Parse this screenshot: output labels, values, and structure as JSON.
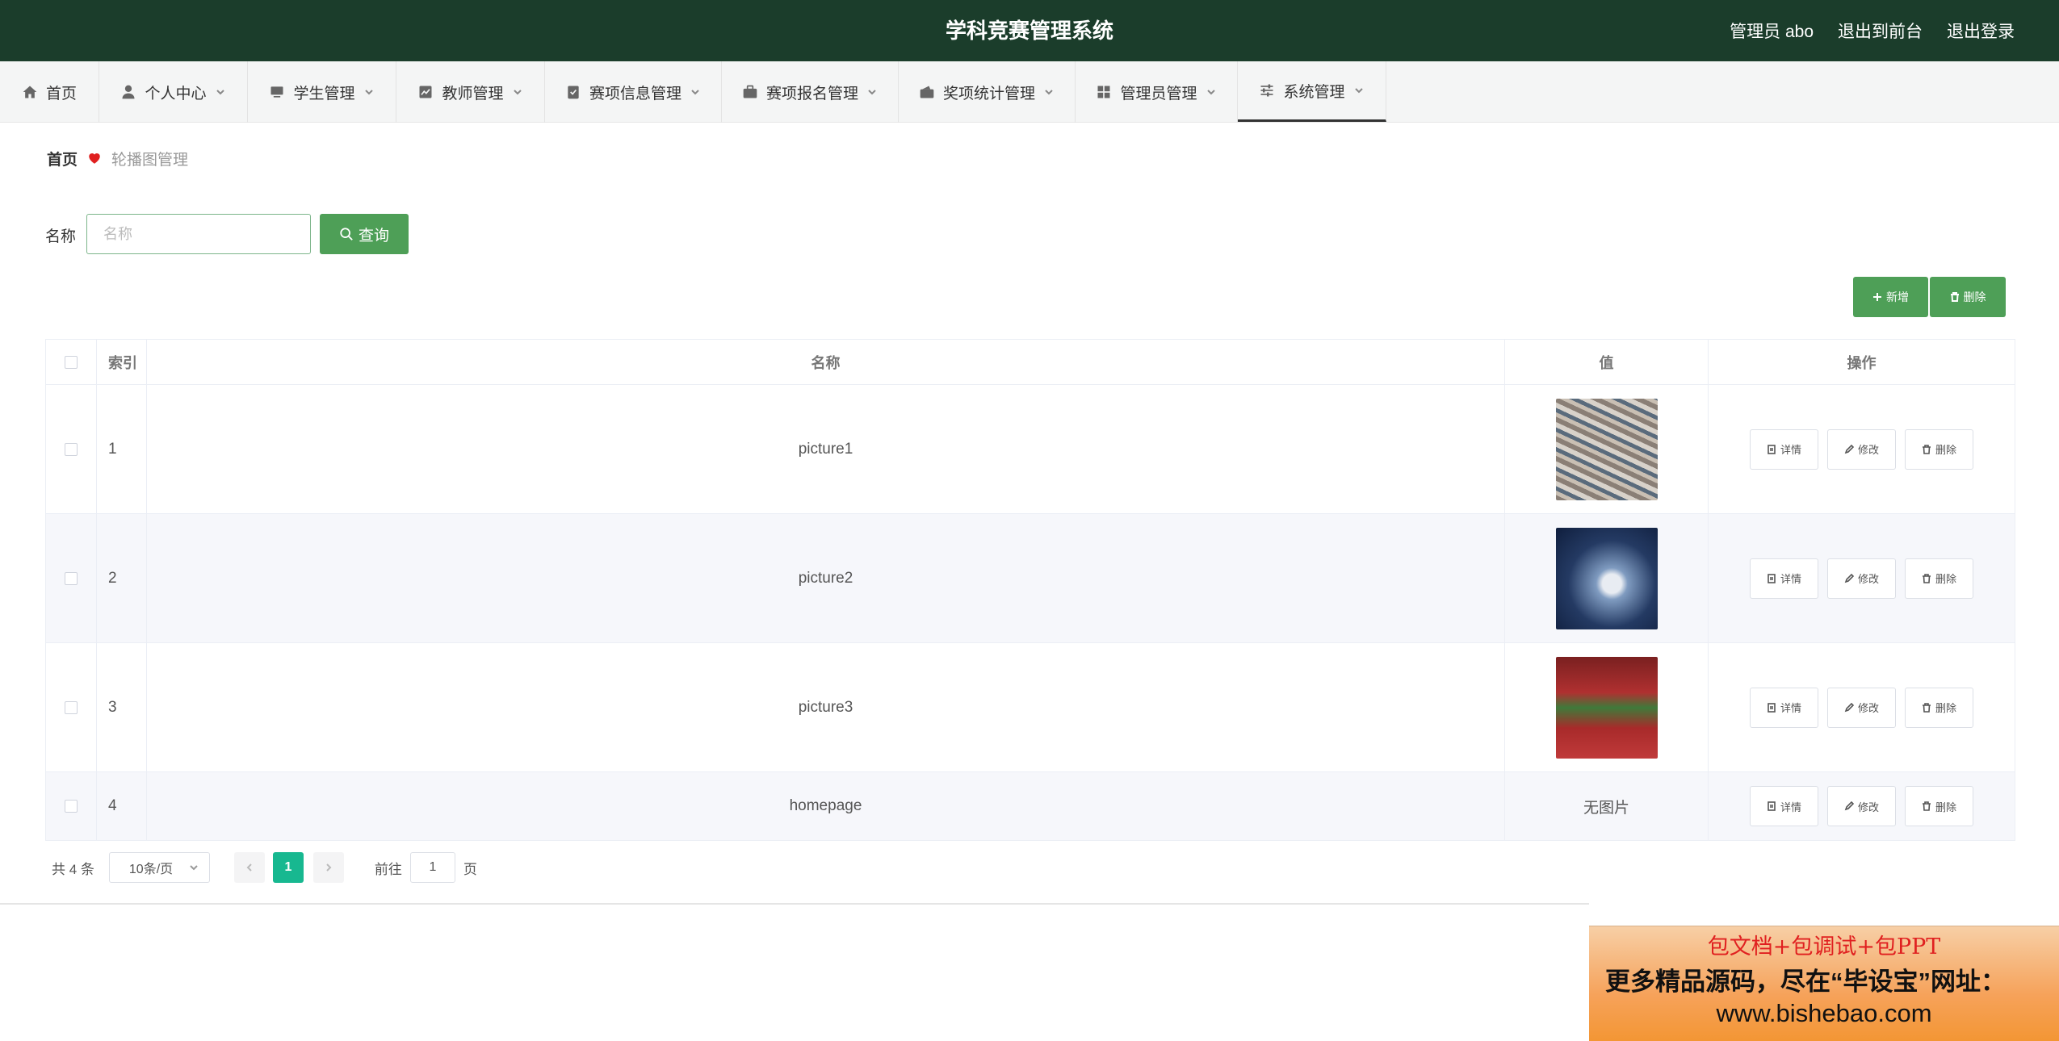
{
  "header": {
    "title": "学科竞赛管理系统",
    "user": "管理员 abo",
    "to_front": "退出到前台",
    "logout": "退出登录"
  },
  "nav": [
    {
      "label": "首页",
      "icon": "home-icon",
      "has_dropdown": false
    },
    {
      "label": "个人中心",
      "icon": "user-icon",
      "has_dropdown": true
    },
    {
      "label": "学生管理",
      "icon": "monitor-icon",
      "has_dropdown": true
    },
    {
      "label": "教师管理",
      "icon": "chart-icon",
      "has_dropdown": true
    },
    {
      "label": "赛项信息管理",
      "icon": "clipboard-icon",
      "has_dropdown": true
    },
    {
      "label": "赛项报名管理",
      "icon": "briefcase-icon",
      "has_dropdown": true
    },
    {
      "label": "奖项统计管理",
      "icon": "wallet-icon",
      "has_dropdown": true
    },
    {
      "label": "管理员管理",
      "icon": "grid-icon",
      "has_dropdown": true
    },
    {
      "label": "系统管理",
      "icon": "sliders-icon",
      "has_dropdown": true,
      "active": true
    }
  ],
  "breadcrumb": {
    "home": "首页",
    "current": "轮播图管理"
  },
  "search": {
    "label": "名称",
    "placeholder": "名称",
    "value": "",
    "button": "查询"
  },
  "actions": {
    "add": "新增",
    "delete": "删除"
  },
  "table": {
    "columns": [
      "索引",
      "名称",
      "值",
      "操作"
    ],
    "rows": [
      {
        "index": "1",
        "name": "picture1",
        "value_type": "image",
        "value_text": ""
      },
      {
        "index": "2",
        "name": "picture2",
        "value_type": "image",
        "value_text": ""
      },
      {
        "index": "3",
        "name": "picture3",
        "value_type": "image",
        "value_text": ""
      },
      {
        "index": "4",
        "name": "homepage",
        "value_type": "text",
        "value_text": "无图片"
      }
    ],
    "row_actions": {
      "detail": "详情",
      "edit": "修改",
      "delete": "删除"
    }
  },
  "pagination": {
    "total": "共 4 条",
    "page_size": "10条/页",
    "current_page": "1",
    "goto_label": "前往",
    "goto_value": "1",
    "page_suffix": "页"
  },
  "promo": {
    "line1": "包文档+包调试+包PPT",
    "line2": "更多精品源码，尽在“毕设宝”网址：",
    "line3": "www.bishebao.com"
  },
  "colors": {
    "header_bg": "#1b3d2b",
    "primary": "#4e9f57",
    "page_active": "#17b890",
    "heart": "#e02020"
  }
}
